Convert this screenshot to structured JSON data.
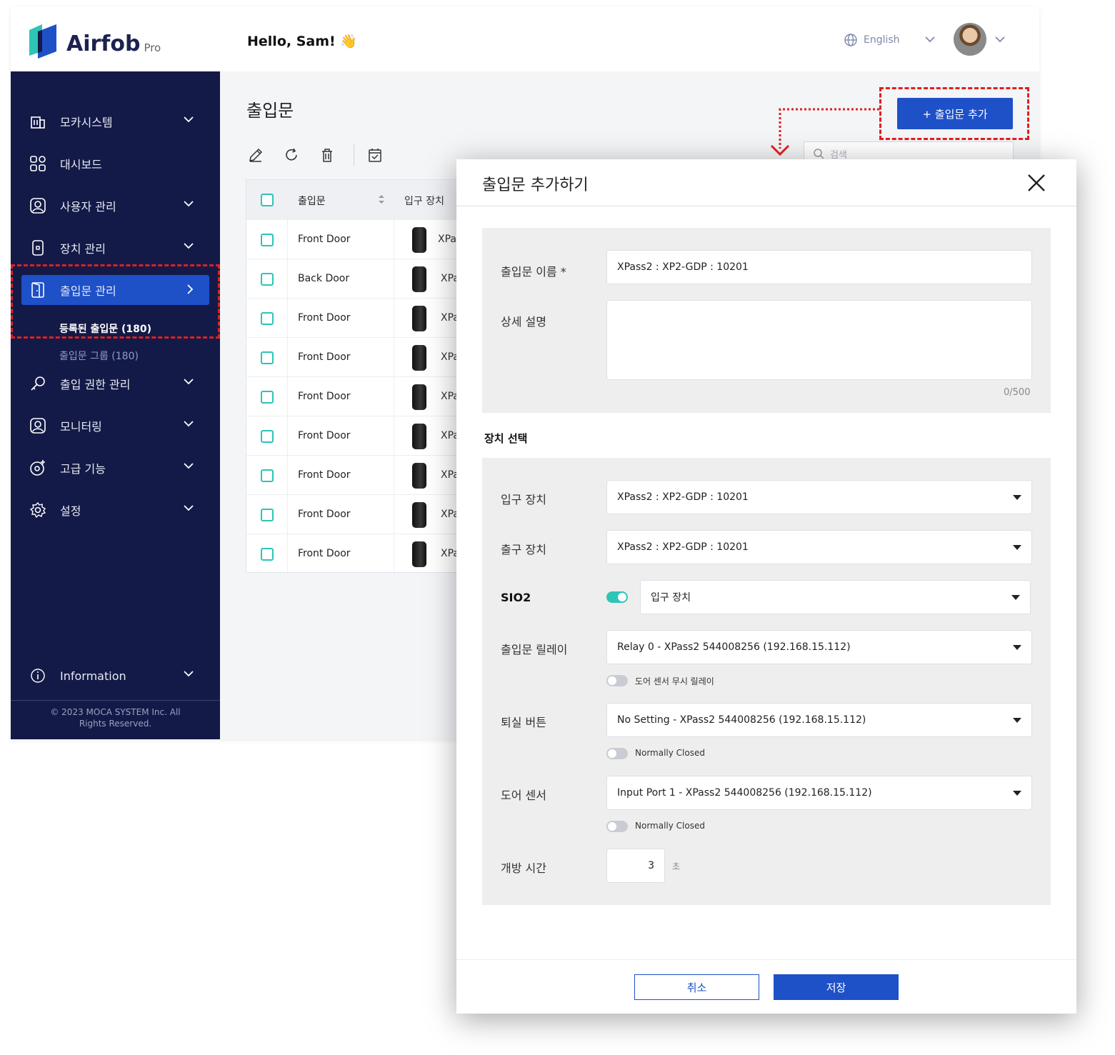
{
  "brand": {
    "name": "Airfob",
    "tier": "Pro"
  },
  "header": {
    "greeting": "Hello, Sam! 👋",
    "language": "English"
  },
  "sidebar": {
    "items": [
      {
        "label": "모카시스템"
      },
      {
        "label": "대시보드"
      },
      {
        "label": "사용자 관리"
      },
      {
        "label": "장치 관리"
      },
      {
        "label": "출입문 관리"
      },
      {
        "label": "출입 권한 관리"
      },
      {
        "label": "모니터링"
      },
      {
        "label": "고급 기능"
      },
      {
        "label": "설정"
      },
      {
        "label": "Information"
      }
    ],
    "sub_items": [
      {
        "label": "등록된 출입문  (180)"
      },
      {
        "label": "출입문 그룹  (180)"
      }
    ],
    "footer": "© 2023 MOCA SYSTEM Inc. All Rights Reserved."
  },
  "page": {
    "title": "출입문",
    "add_button": "+  출입문 추가",
    "search_placeholder": "검색"
  },
  "table": {
    "columns": [
      "출입문",
      "입구 장치"
    ],
    "rows": [
      {
        "name": "Front Door",
        "device": "XPa"
      },
      {
        "name": "Back Door",
        "device": "XPa"
      },
      {
        "name": "Front Door",
        "device": "XPa"
      },
      {
        "name": "Front Door",
        "device": "XPa"
      },
      {
        "name": "Front Door",
        "device": "XPa"
      },
      {
        "name": "Front Door",
        "device": "XPa"
      },
      {
        "name": "Front Door",
        "device": "XPa"
      },
      {
        "name": "Front Door",
        "device": "XPa"
      },
      {
        "name": "Front Door",
        "device": "XPa"
      }
    ]
  },
  "modal": {
    "title": "출입문 추가하기",
    "door_name_label": "출입문 이름 *",
    "door_name_value": "XPass2 : XP2-GDP : 10201",
    "description_label": "상세 설명",
    "description_counter": "0/500",
    "device_section_title": "장치 선택",
    "entry_device_label": "입구 장치",
    "entry_device_value": "XPass2 : XP2-GDP : 10201",
    "exit_device_label": "출구 장치",
    "exit_device_value": "XPass2 : XP2-GDP : 10201",
    "sio2_label": "SIO2",
    "sio2_value": "입구 장치",
    "relay_label": "출입문 릴레이",
    "relay_value": "Relay 0 - XPass2 544008256 (192.168.15.112)",
    "relay_toggle_label": "도어 센서 무시 릴레이",
    "exit_button_label": "퇴실 버튼",
    "exit_button_value": "No Setting - XPass2 544008256 (192.168.15.112)",
    "exit_button_toggle_label": "Normally Closed",
    "door_sensor_label": "도어 센서",
    "door_sensor_value": "Input Port 1 - XPass2 544008256 (192.168.15.112)",
    "door_sensor_toggle_label": "Normally Closed",
    "open_time_label": "개방 시간",
    "open_time_value": "3",
    "open_time_unit": "초",
    "cancel_label": "취소",
    "save_label": "저장"
  },
  "colors": {
    "primary": "#1e50c8",
    "sidebar": "#141a47",
    "accent": "#2ec4b6",
    "highlight": "#e02020"
  }
}
